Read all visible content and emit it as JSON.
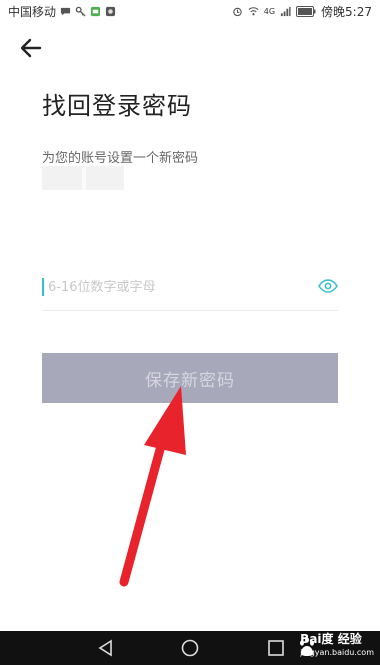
{
  "status_bar": {
    "carrier": "中国移动",
    "network_label": "4G",
    "time": "傍晚5:27"
  },
  "header": {
    "title": "找回登录密码",
    "subtitle": "为您的账号设置一个新密码"
  },
  "password": {
    "placeholder": "6-16位数字或字母",
    "value": ""
  },
  "save_button": {
    "label": "保存新密码"
  },
  "watermark": {
    "brand": "Bai度 经验",
    "url": "jingyan.baidu.com"
  },
  "colors": {
    "accent": "#3bbfc7",
    "button_disabled": "#a8a8bb",
    "annotation_arrow": "#e8232b"
  }
}
